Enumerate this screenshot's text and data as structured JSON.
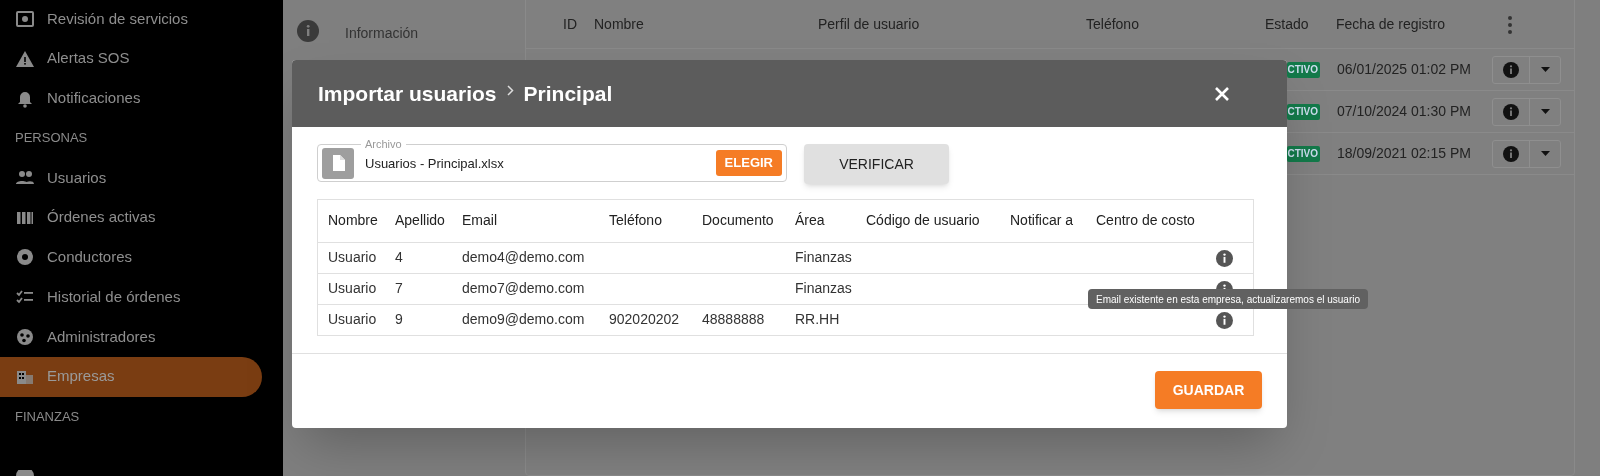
{
  "sidebar": {
    "items": [
      {
        "kind": "item",
        "label": "Revisión de servicios",
        "selected": false
      },
      {
        "kind": "item",
        "label": "Alertas SOS",
        "selected": false
      },
      {
        "kind": "item",
        "label": "Notificaciones",
        "selected": false
      },
      {
        "kind": "section",
        "label": "PERSONAS"
      },
      {
        "kind": "item",
        "label": "Usuarios",
        "selected": false
      },
      {
        "kind": "item",
        "label": "Órdenes activas",
        "selected": false
      },
      {
        "kind": "item",
        "label": "Conductores",
        "selected": false
      },
      {
        "kind": "item",
        "label": "Historial de órdenes",
        "selected": false
      },
      {
        "kind": "item",
        "label": "Administradores",
        "selected": false
      },
      {
        "kind": "item",
        "label": "Empresas",
        "selected": true
      },
      {
        "kind": "section",
        "label": "FINANZAS"
      }
    ]
  },
  "info_panel": {
    "label": "Información"
  },
  "background_table": {
    "columns": [
      "ID",
      "Nombre",
      "Perfil de usuario",
      "Teléfono",
      "Estado",
      "Fecha de registro"
    ],
    "rows": [
      {
        "status": "CTIVO",
        "date": "06/01/2025 01:02 PM"
      },
      {
        "status": "CTIVO",
        "date": "07/10/2024 01:30 PM"
      },
      {
        "status": "CTIVO",
        "date": "18/09/2021 02:15 PM"
      }
    ]
  },
  "modal": {
    "breadcrumb": [
      "Importar usuarios",
      "Principal"
    ],
    "file_field": {
      "label": "Archivo",
      "value": "Usuarios - Principal.xlsx",
      "button": "ELEGIR"
    },
    "verify_button": "VERIFICAR",
    "table": {
      "columns": [
        "Nombre",
        "Apellido",
        "Email",
        "Teléfono",
        "Documento",
        "Área",
        "Código de usuario",
        "Notificar a",
        "Centro de costo"
      ],
      "rows": [
        {
          "cells": [
            "Usuario",
            "4",
            "demo4@demo.com",
            "",
            "",
            "Finanzas",
            "",
            "",
            ""
          ]
        },
        {
          "cells": [
            "Usuario",
            "7",
            "demo7@demo.com",
            "",
            "",
            "Finanzas",
            "",
            "",
            ""
          ],
          "tooltip": "Email existente en esta empresa, actualizaremos el usuario"
        },
        {
          "cells": [
            "Usuario",
            "9",
            "demo9@demo.com",
            "902020202",
            "48888888",
            "RR.HH",
            "",
            "",
            ""
          ]
        }
      ]
    },
    "save_button": "GUARDAR"
  }
}
